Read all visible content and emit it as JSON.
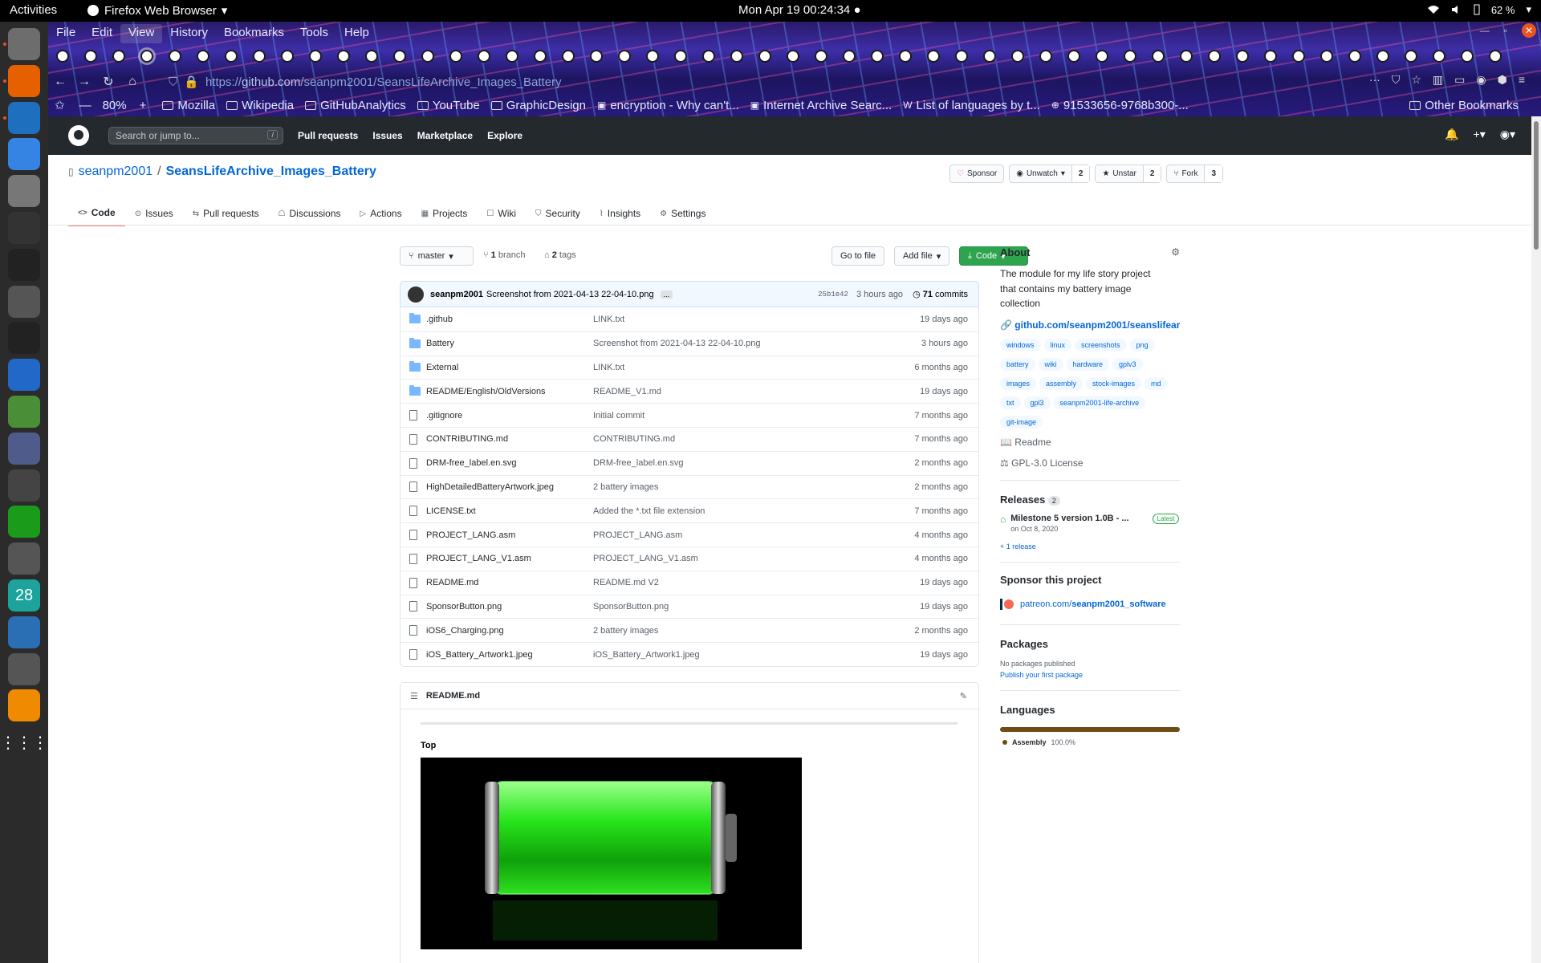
{
  "system": {
    "activities": "Activities",
    "app_name": "Firefox Web Browser",
    "clock": "Mon Apr 19  00:24:34",
    "battery": "62 %"
  },
  "dock": {
    "calendar_day": "28",
    "icons": [
      "files-icon",
      "firefox-icon",
      "writer-icon",
      "help-icon",
      "settings-icon",
      "system-monitor-icon",
      "terminal-icon",
      "search-icon",
      "sysprof-icon",
      "text-editor-icon",
      "boxes-icon",
      "tweaks-icon",
      "clock-icon",
      "vim-icon",
      "disk-icon",
      "calendar-icon",
      "virtualbox-icon",
      "magnifier-icon",
      "vlc-icon",
      "app-grid-icon"
    ]
  },
  "firefox": {
    "menu": [
      "File",
      "Edit",
      "View",
      "History",
      "Bookmarks",
      "Tools",
      "Help"
    ],
    "active_menu": "View",
    "tab_count": 52,
    "url_scheme": "https://",
    "url_host": "github.com",
    "url_path": "/seanpm2001/SeansLifeArchive_Images_Battery",
    "zoom": "80%",
    "bookmarks": [
      {
        "label": "Mozilla",
        "icon": "folder-icon"
      },
      {
        "label": "Wikipedia",
        "icon": "folder-icon"
      },
      {
        "label": "GitHubAnalytics",
        "icon": "folder-icon"
      },
      {
        "label": "YouTube",
        "icon": "folder-icon"
      },
      {
        "label": "GraphicDesign",
        "icon": "folder-icon"
      },
      {
        "label": "encryption - Why can't...",
        "icon": "stackexchange-icon"
      },
      {
        "label": "Internet Archive Searc...",
        "icon": "archive-icon"
      },
      {
        "label": "List of languages by t...",
        "icon": "wikipedia-icon"
      },
      {
        "label": "91533656-9768b300-...",
        "icon": "globe-icon"
      }
    ],
    "other_bookmarks": "Other Bookmarks"
  },
  "github": {
    "search_placeholder": "Search or jump to...",
    "search_key": "/",
    "nav": [
      "Pull requests",
      "Issues",
      "Marketplace",
      "Explore"
    ],
    "owner": "seanpm2001",
    "separator": "/",
    "repo": "SeansLifeArchive_Images_Battery",
    "actions": {
      "sponsor": "Sponsor",
      "watch": "Unwatch",
      "watch_count": "2",
      "star": "Unstar",
      "star_count": "2",
      "fork": "Fork",
      "fork_count": "3"
    },
    "tabs": [
      "Code",
      "Issues",
      "Pull requests",
      "Discussions",
      "Actions",
      "Projects",
      "Wiki",
      "Security",
      "Insights",
      "Settings"
    ],
    "branch": "master",
    "branch_count": "1",
    "branch_label": "branch",
    "tag_count": "2",
    "tag_label": "tags",
    "goto_file": "Go to file",
    "add_file": "Add file",
    "code_btn": "Code",
    "commit": {
      "author": "seanpm2001",
      "message": "Screenshot from 2021-04-13 22-04-10.png",
      "ellipsis": "...",
      "sha": "25b1e42",
      "time": "3 hours ago",
      "count": "71",
      "count_label": "commits"
    },
    "files": [
      {
        "type": "dir",
        "name": ".github",
        "msg": "LINK.txt",
        "age": "19 days ago"
      },
      {
        "type": "dir",
        "name": "Battery",
        "msg": "Screenshot from 2021-04-13 22-04-10.png",
        "age": "3 hours ago"
      },
      {
        "type": "dir",
        "name": "External",
        "msg": "LINK.txt",
        "age": "6 months ago"
      },
      {
        "type": "dir",
        "name": "README/English/OldVersions",
        "msg": "README_V1.md",
        "age": "19 days ago"
      },
      {
        "type": "file",
        "name": ".gitignore",
        "msg": "Initial commit",
        "age": "7 months ago"
      },
      {
        "type": "file",
        "name": "CONTRIBUTING.md",
        "msg": "CONTRIBUTING.md",
        "age": "7 months ago"
      },
      {
        "type": "file",
        "name": "DRM-free_label.en.svg",
        "msg": "DRM-free_label.en.svg",
        "age": "2 months ago"
      },
      {
        "type": "file",
        "name": "HighDetailedBatteryArtwork.jpeg",
        "msg": "2 battery images",
        "age": "2 months ago"
      },
      {
        "type": "file",
        "name": "LICENSE.txt",
        "msg": "Added the *.txt file extension",
        "age": "7 months ago"
      },
      {
        "type": "file",
        "name": "PROJECT_LANG.asm",
        "msg": "PROJECT_LANG.asm",
        "age": "4 months ago"
      },
      {
        "type": "file",
        "name": "PROJECT_LANG_V1.asm",
        "msg": "PROJECT_LANG_V1.asm",
        "age": "4 months ago"
      },
      {
        "type": "file",
        "name": "README.md",
        "msg": "README.md V2",
        "age": "19 days ago"
      },
      {
        "type": "file",
        "name": "SponsorButton.png",
        "msg": "SponsorButton.png",
        "age": "19 days ago"
      },
      {
        "type": "file",
        "name": "iOS6_Charging.png",
        "msg": "2 battery images",
        "age": "2 months ago"
      },
      {
        "type": "file",
        "name": "iOS_Battery_Artwork1.jpeg",
        "msg": "iOS_Battery_Artwork1.jpeg",
        "age": "19 days ago"
      }
    ],
    "readme": {
      "title": "README.md",
      "heading": "Top"
    },
    "about": {
      "title": "About",
      "description": "The module for my life story project that contains my battery image collection",
      "website": "github.com/seanpm2001/seanslifear...",
      "topics": [
        "windows",
        "linux",
        "screenshots",
        "png",
        "battery",
        "wiki",
        "hardware",
        "gplv3",
        "images",
        "assembly",
        "stock-images",
        "md",
        "txt",
        "gpl3",
        "seanpm2001-life-archive",
        "git-image"
      ],
      "readme": "Readme",
      "license": "GPL-3.0 License"
    },
    "releases": {
      "title": "Releases",
      "count": "2",
      "name": "Milestone 5 version 1.0B - ...",
      "badge": "Latest",
      "date": "on Oct 8, 2020",
      "more": "+ 1 release"
    },
    "sponsor": {
      "title": "Sponsor this project",
      "link_pre": "patreon.com/",
      "link_bold": "seanpm2001_software"
    },
    "packages": {
      "title": "Packages",
      "none": "No packages published",
      "publish": "Publish your first package"
    },
    "languages": {
      "title": "Languages",
      "name": "Assembly",
      "percent": "100.0%",
      "color": "#6E4C13"
    }
  },
  "colors": {
    "gh_header": "#24292e",
    "link": "#0366d6",
    "green": "#2ea44f",
    "ubuntu_orange": "#e95420"
  }
}
